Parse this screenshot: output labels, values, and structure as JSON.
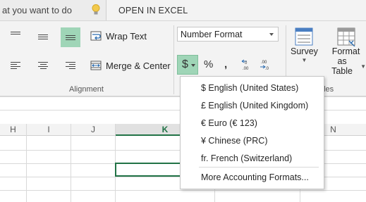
{
  "topbar": {
    "search_text": "at you want to do",
    "open_in_excel": "OPEN IN EXCEL"
  },
  "ribbon": {
    "wrap_text_label": "Wrap Text",
    "merge_center_label": "Merge & Center",
    "alignment_group_label": "Alignment",
    "number_format_value": "Number Format",
    "accounting_symbol": "$",
    "percent_symbol": "%",
    "comma_symbol": ",",
    "survey_label": "Survey",
    "format_as_table_line1": "Format",
    "format_as_table_line2": "as Table",
    "tables_group_label": "bles"
  },
  "grid": {
    "columns": [
      "H",
      "I",
      "J",
      "K",
      "N"
    ],
    "selected_column": "K"
  },
  "accounting_menu": {
    "items": [
      "$ English (United States)",
      "£ English (United Kingdom)",
      "€ Euro (€ 123)",
      "¥ Chinese (PRC)",
      "fr. French (Switzerland)"
    ],
    "more": "More Accounting Formats..."
  },
  "colors": {
    "accent_green": "#217346",
    "active_button": "#9fd5b7"
  },
  "icons": [
    "lightbulb-icon",
    "align-top-icon",
    "align-middle-icon",
    "align-bottom-icon",
    "align-left-icon",
    "align-center-icon",
    "align-right-icon",
    "wrap-text-icon",
    "merge-center-icon",
    "chevron-down-icon",
    "increase-decimal-icon",
    "decrease-decimal-icon",
    "survey-icon",
    "format-as-table-icon"
  ]
}
